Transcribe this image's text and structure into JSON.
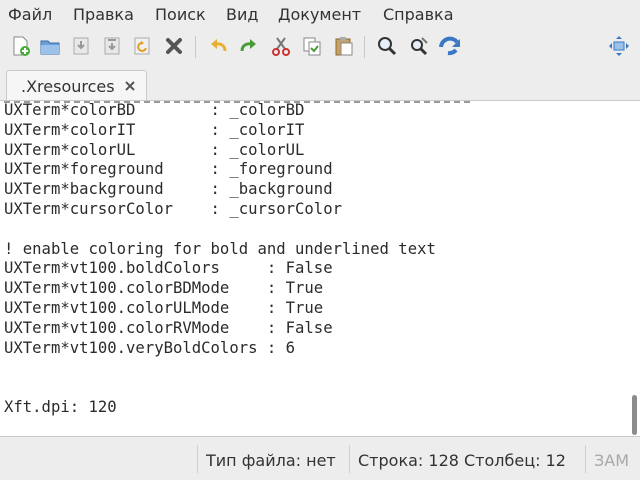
{
  "menubar": {
    "items": [
      "Файл",
      "Правка",
      "Поиск",
      "Вид",
      "Документ",
      "Справка"
    ]
  },
  "toolbar": {
    "icons": [
      "new-file-icon",
      "open-folder-icon",
      "save-icon",
      "save-all-icon",
      "revert-icon",
      "close-icon",
      "undo-icon",
      "redo-icon",
      "cut-icon",
      "copy-icon",
      "paste-icon",
      "find-icon",
      "find-replace-icon",
      "jump-to-icon",
      "fullscreen-icon"
    ]
  },
  "tabs": [
    {
      "label": ".Xresources",
      "close_icon": "close-icon"
    }
  ],
  "editor": {
    "lines": [
      "UXTerm*colorBD        : _colorBD",
      "UXTerm*colorIT        : _colorIT",
      "UXTerm*colorUL        : _colorUL",
      "UXTerm*foreground     : _foreground",
      "UXTerm*background     : _background",
      "UXTerm*cursorColor    : _cursorColor",
      "",
      "! enable coloring for bold and underlined text",
      "UXTerm*vt100.boldColors     : False",
      "UXTerm*vt100.colorBDMode    : True",
      "UXTerm*vt100.colorULMode    : True",
      "UXTerm*vt100.colorRVMode    : False",
      "UXTerm*vt100.veryBoldColors : 6",
      "",
      "",
      "Xft.dpi: 120"
    ]
  },
  "statusbar": {
    "file_type": "Тип файла: нет",
    "position": "Строка: 128 Столбец: 12",
    "mode": "ЗАМ"
  },
  "colors": {
    "accent_blue": "#3b78c4",
    "accent_red": "#cc3333",
    "undo_yellow": "#e8b030",
    "redo_green": "#4a9a3a"
  }
}
